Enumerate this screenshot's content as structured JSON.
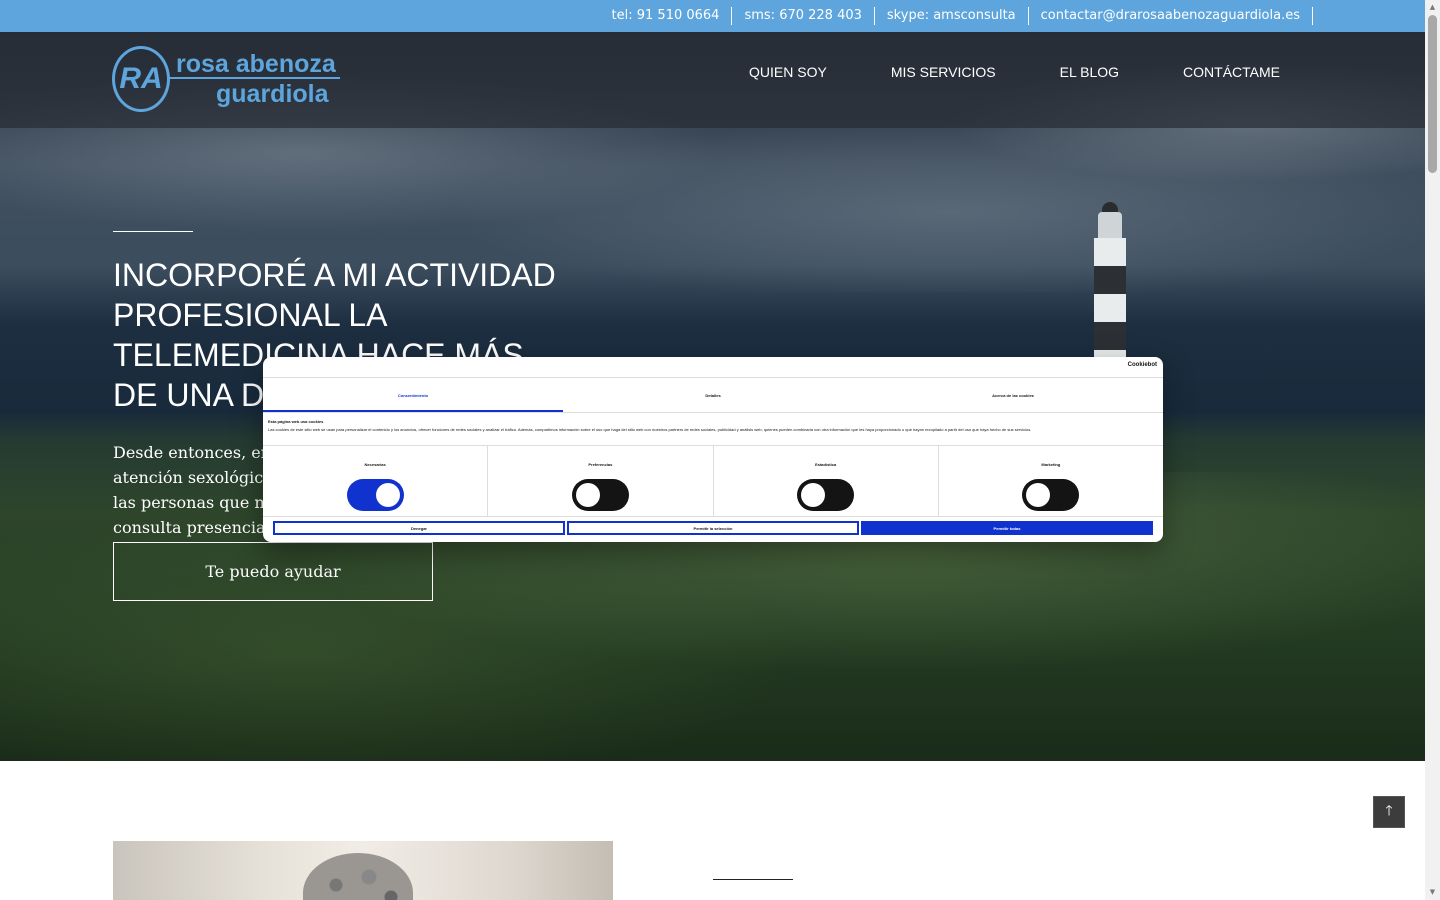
{
  "topbar": {
    "items": [
      "tel: 91 510 0664",
      "sms: 670 228 403",
      "skype: amsconsulta",
      "contactar@drarosaabenozaguardiola.es"
    ],
    "color": "#5da5dc"
  },
  "logo": {
    "mark": "RA",
    "line1": "rosa abenoza",
    "line2": "guardiola"
  },
  "nav": {
    "items": [
      "QUIEN SOY",
      "MIS SERVICIOS",
      "EL BLOG",
      "CONTÁCTAME"
    ]
  },
  "hero": {
    "title": "INCORPORÉ A MI ACTIVIDAD PROFESIONAL LA TELEMEDICINA HACE MÁS DE UNA DÉCADA",
    "text": "Desde entonces, encuentro la forma de ofrecer una atención sexológica y psicoterapéutica de calidad a todas las personas que no pueden o no quieren acudir a la consulta presencial.",
    "button": "Te puedo ayudar"
  },
  "cookie": {
    "brand": "Cookiebot",
    "tabs": [
      "Consentimiento",
      "Detalles",
      "Acerca de las cookies"
    ],
    "title": "Esta página web usa cookies",
    "text": "Las cookies de este sitio web se usan para personalizar el contenido y los anuncios, ofrecer funciones de redes sociales y analizar el tráfico. Además, compartimos información sobre el uso que haga del sitio web con nuestros partners de redes sociales, publicidad y análisis web, quienes pueden combinarla con otra información que les haya proporcionado o que hayan recopilado a partir del uso que haya hecho de sus servicios.",
    "toggles": [
      {
        "label": "Necesarias",
        "on": true
      },
      {
        "label": "Preferencias",
        "on": false
      },
      {
        "label": "Estadística",
        "on": false
      },
      {
        "label": "Marketing",
        "on": false
      }
    ],
    "buttons": [
      "Denegar",
      "Permitir la selección",
      "Permitir todas"
    ],
    "accent": "#1032cf"
  },
  "to_top_icon": "arrow-up-icon"
}
